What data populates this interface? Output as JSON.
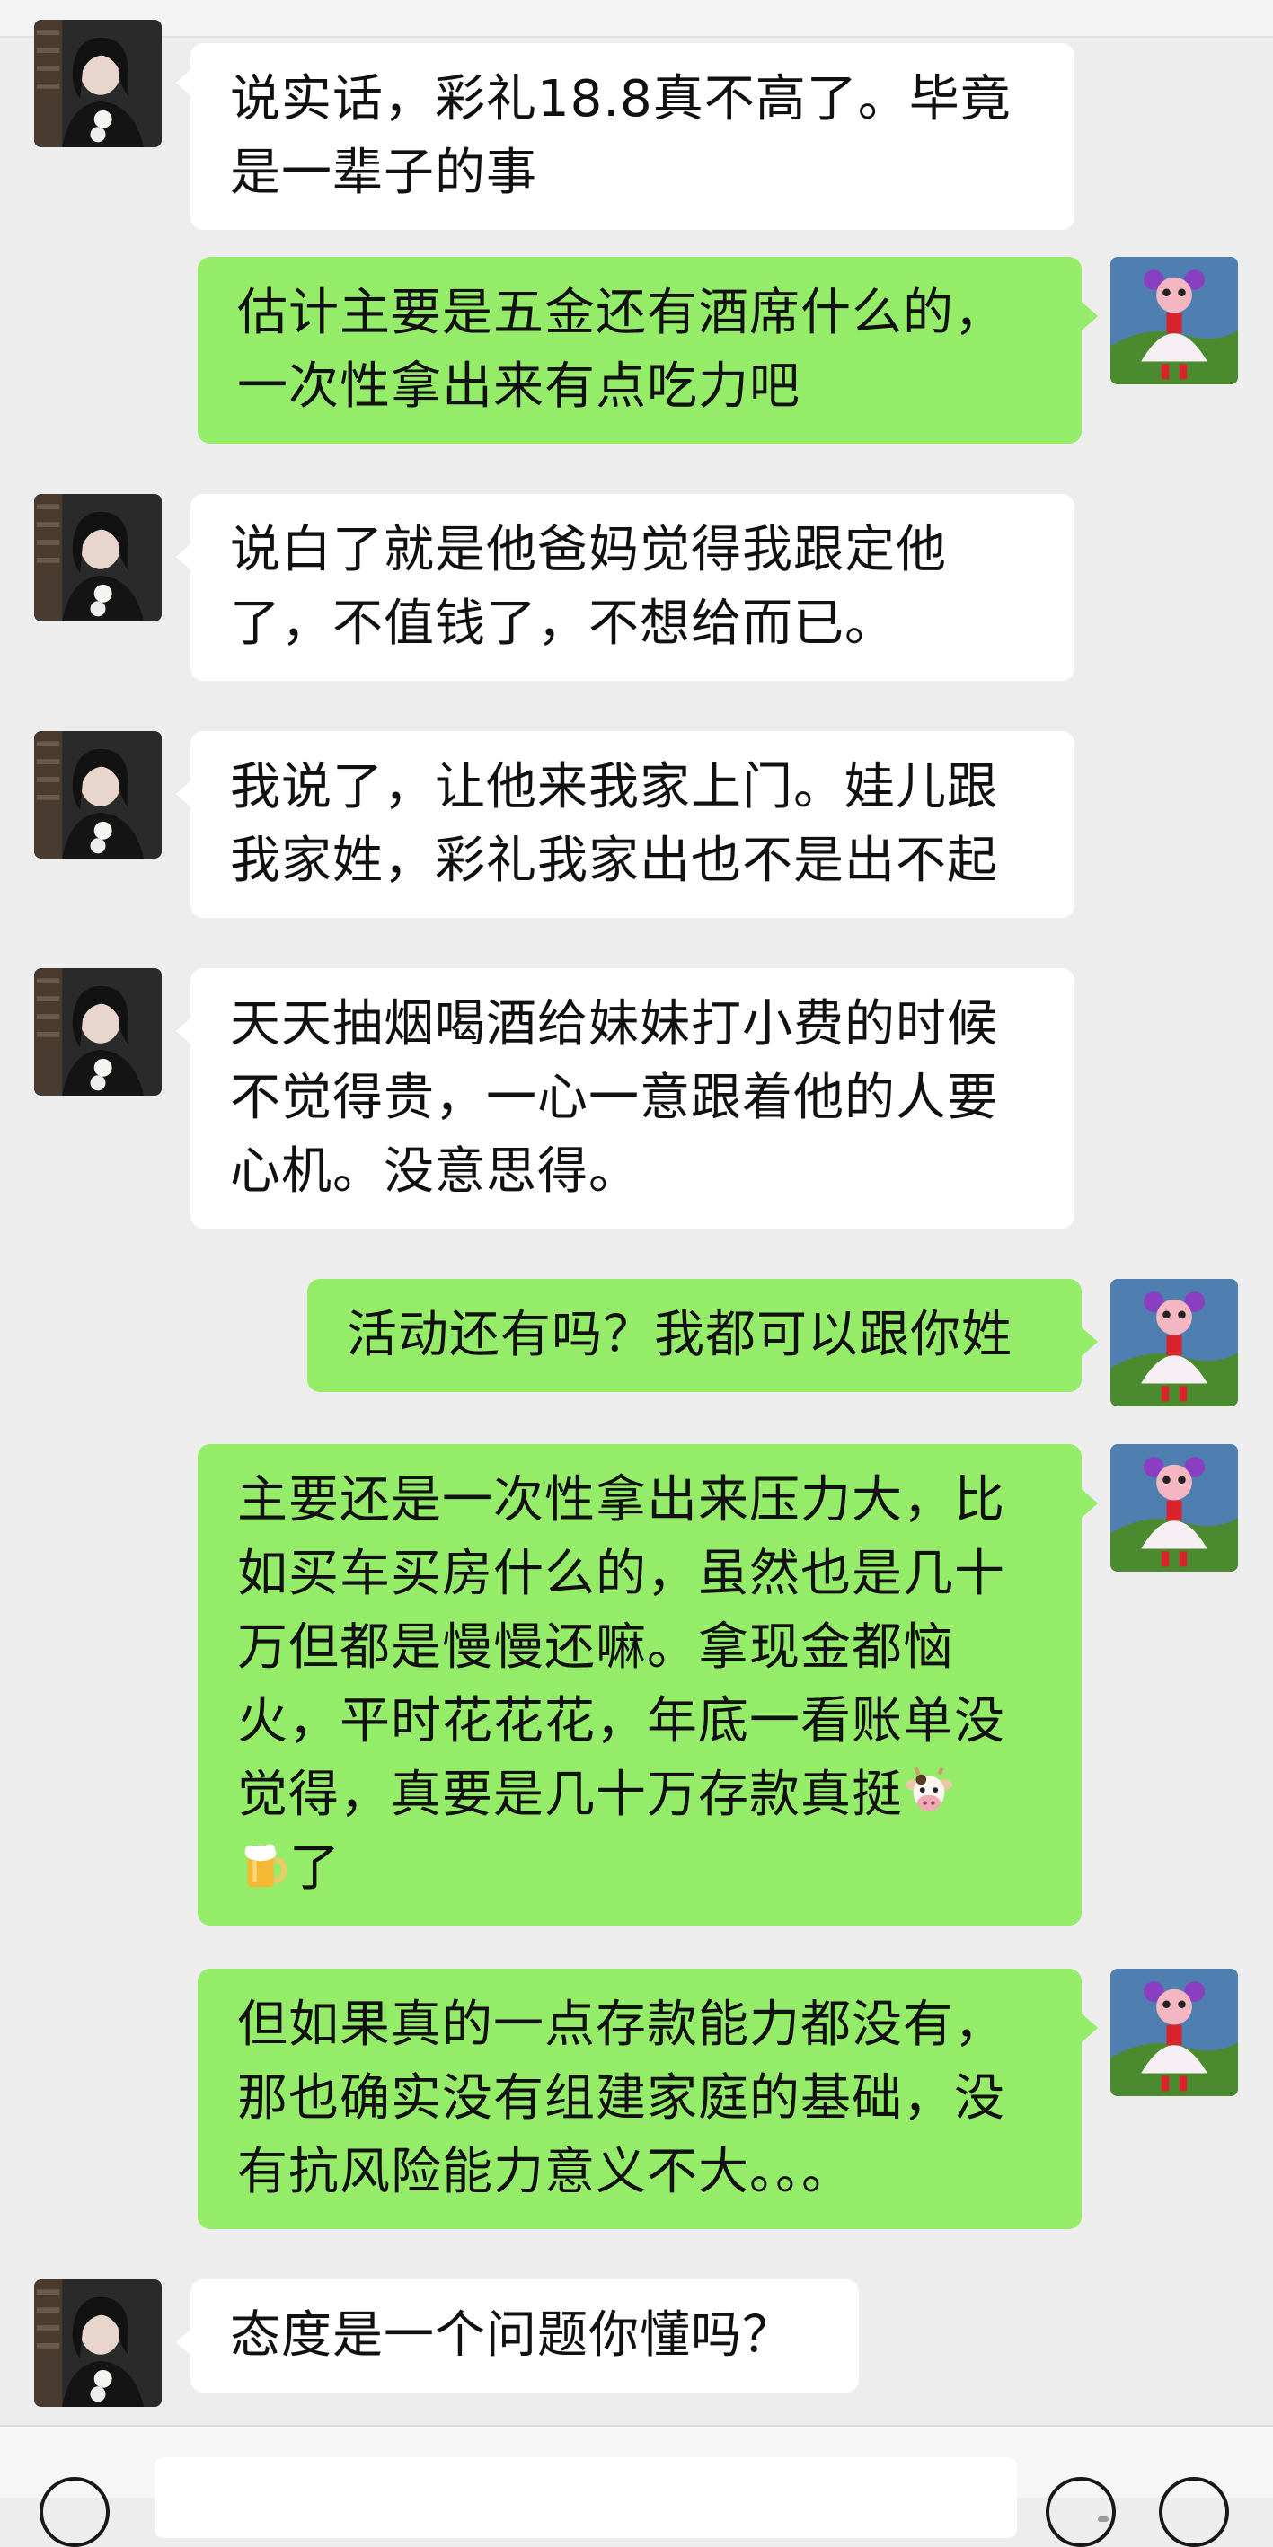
{
  "colors": {
    "background": "#ededed",
    "incoming_bubble": "#ffffff",
    "outgoing_bubble": "#95ec69",
    "text": "#111111"
  },
  "messages": [
    {
      "side": "incoming",
      "text": "说实话，彩礼18.8真不高了。毕竟是一辈子的事"
    },
    {
      "side": "outgoing",
      "text": "估计主要是五金还有酒席什么的，一次性拿出来有点吃力吧"
    },
    {
      "side": "incoming",
      "text": "说白了就是他爸妈觉得我跟定他了，不值钱了，不想给而已。"
    },
    {
      "side": "incoming",
      "text": "我说了，让他来我家上门。娃儿跟我家姓，彩礼我家出也不是出不起"
    },
    {
      "side": "incoming",
      "text": "天天抽烟喝酒给妹妹打小费的时候不觉得贵，一心一意跟着他的人要心机。没意思得。"
    },
    {
      "side": "outgoing",
      "text": "活动还有吗？我都可以跟你姓"
    },
    {
      "side": "outgoing",
      "text_before_emoji": "主要还是一次性拿出来压力大，比如买车买房什么的，虽然也是几十万但都是慢慢还嘛。拿现金都恼火，平时花花花，年底一看账单没觉得，真要是几十万存款真挺",
      "emoji_1": "cow-face-emoji",
      "emoji_2": "beer-mug-emoji",
      "text_after_emoji": "了"
    },
    {
      "side": "outgoing",
      "text": "但如果真的一点存款能力都没有，那也确实没有组建家庭的基础，没有抗风险能力意义不大。。。"
    },
    {
      "side": "incoming",
      "text": "态度是一个问题你懂吗？"
    }
  ],
  "input_bar": {
    "left_icon": "voice-icon",
    "right_icons": [
      "emoji-icon",
      "plus-icon"
    ]
  }
}
